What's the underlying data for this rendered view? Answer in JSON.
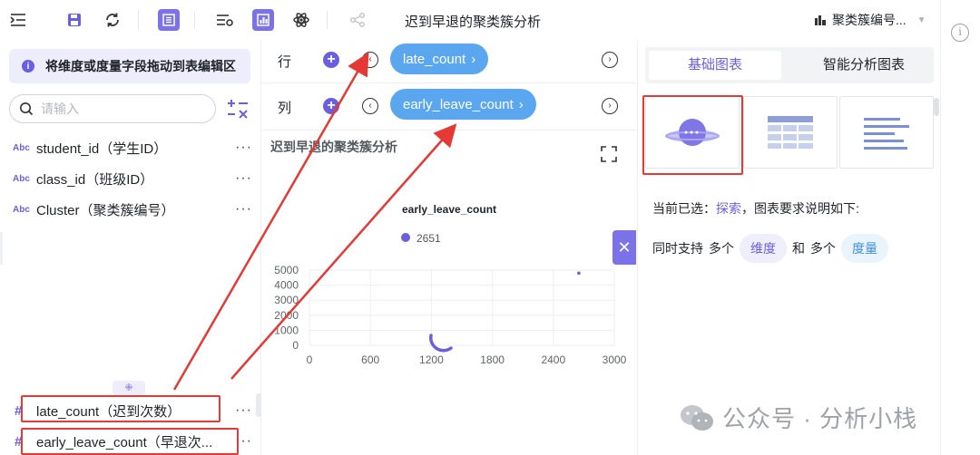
{
  "app": {
    "title": "迟到早退的聚类簇分析",
    "dataset": "聚类簇编号..."
  },
  "left": {
    "hint": "将维度或度量字段拖动到表编辑区",
    "search_placeholder": "请输入",
    "dimension_type": "Abc",
    "dimensions": [
      {
        "label": "student_id（学生ID）"
      },
      {
        "label": "class_id（班级ID）"
      },
      {
        "label": "Cluster（聚类簇编号）"
      }
    ],
    "measures": [
      {
        "label": "late_count（迟到次数）"
      },
      {
        "label": "early_leave_count（早退次..."
      }
    ],
    "more": "···"
  },
  "shelves": {
    "row_label": "行",
    "row_field": "late_count",
    "col_label": "列",
    "col_field": "early_leave_count"
  },
  "chart_data": {
    "type": "scatter",
    "title": "迟到早退的聚类簇分析",
    "legend_title": "early_leave_count",
    "legend_items": [
      "2651"
    ],
    "xlabel": "",
    "ylabel": "",
    "xlim": [
      0,
      3000
    ],
    "ylim": [
      0,
      5000
    ],
    "xticks": [
      0,
      600,
      1200,
      1800,
      2400,
      3000
    ],
    "yticks": [
      0,
      1000,
      2000,
      3000,
      4000,
      5000
    ],
    "grid": true,
    "points": [
      {
        "x": 2651,
        "y": 4800
      }
    ],
    "colors": {
      "point": "#6a5fe0"
    }
  },
  "right": {
    "tabs": [
      "基础图表",
      "智能分析图表"
    ],
    "active_tab": 0,
    "desc_prefix": "当前已选：",
    "desc_link": "探索",
    "desc_suffix": "，图表要求说明如下:",
    "support_text": "同时支持",
    "multi": "多个",
    "and": "和",
    "dim_tag": "维度",
    "mea_tag": "度量"
  },
  "watermark": {
    "text": "公众号 · 分析小栈"
  },
  "colors": {
    "accent": "#6a5fe0",
    "pill": "#5aa7f0",
    "highlight": "#e53935"
  }
}
